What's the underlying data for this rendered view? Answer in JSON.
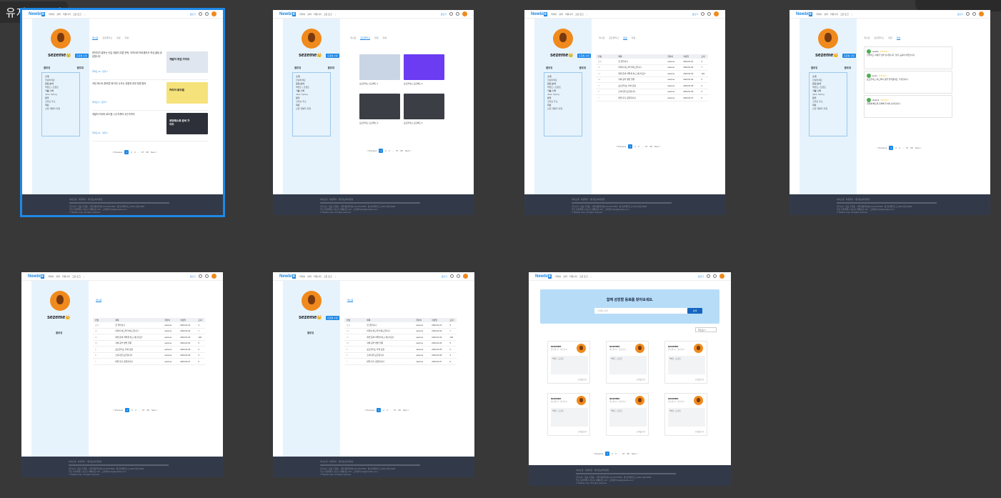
{
  "frame_label": "유저 프로필",
  "nav": {
    "logo": "Newbi",
    "logo_box": "e",
    "menu": [
      "커리어",
      "강좌",
      "커뮤니티",
      "고민 토크"
    ],
    "more": "⋮",
    "write": "글쓰기"
  },
  "profile": {
    "name": "sezeme",
    "crown": "👑",
    "edit": "프로필 수정",
    "stats": [
      "팔로잉",
      "팔로워"
    ],
    "box_lines": [
      "소개",
      "안녕하세요",
      "관심 분야",
      "백엔드 | 프론트",
      "기술 스택",
      "Java, Spring",
      "링크",
      "깃허브 주소",
      "목표",
      "신입 개발자 취업"
    ],
    "solo_stat": "팔로잉"
  },
  "tabs": {
    "feed": [
      "게시글",
      "포트폴리오",
      "댓글",
      "리뷰"
    ],
    "board": [
      "게시글"
    ]
  },
  "pagination": {
    "prev": "< Previous",
    "pages": [
      "1",
      "2",
      "3",
      "...",
      "67",
      "68"
    ],
    "next": "Next >"
  },
  "posts": [
    {
      "text": "현직자가 말하는 신입 개발자 취업 전략, 이력서와 포트폴리오 작성 꿀팁 공유합니다",
      "meta": "좋아요 12 · 댓글 3"
    },
    {
      "text": "코딩 테스트 준비할 때 자주 나오는 유형과 공부 방법 정리",
      "meta": "좋아요 8 · 댓글 5"
    },
    {
      "text": "개발자 커리어 로드맵, 1년 차부터 3년 차까지",
      "meta": "좋아요 21 · 댓글 9"
    }
  ],
  "thumbs": [
    {
      "label": "개발자 취업 가이드",
      "color": "#dfe6ef"
    },
    {
      "label": "커리어 로드맵",
      "color": "#f6e27a"
    },
    {
      "label": "코딩테스트 준비 가이드",
      "color": "#2d3039"
    }
  ],
  "gallery": [
    {
      "caption": "포트폴리오 프로젝트 1",
      "color": "#c9d4e4"
    },
    {
      "caption": "포트폴리오 프로젝트 2",
      "color": "#6b3cf2"
    },
    {
      "caption": "포트폴리오 프로젝트 3",
      "color": "#3b3e45"
    },
    {
      "caption": "포트폴리오 프로젝트 4",
      "color": "#3b3e45"
    }
  ],
  "table": {
    "headers": [
      "번호",
      "제목",
      "글쓴이",
      "작성일",
      "조회"
    ],
    "rows": [
      [
        "공지",
        "첫 글입니다",
        "sezeme",
        "2024.01.01",
        "3"
      ],
      [
        "12",
        "이력서 피드백 부탁드립니다",
        "sezeme",
        "2024.01.02",
        "7"
      ],
      [
        "11",
        "취업 준비 어떻게 하고 계신가요?",
        "sezeme",
        "2024.01.03",
        "104"
      ],
      [
        "10",
        "자바 공부 방법 질문",
        "sezeme",
        "2024.01.04",
        "5"
      ],
      [
        "9",
        "포트폴리오 리뷰 요청",
        "sezeme",
        "2024.01.05",
        "2"
      ],
      [
        "8",
        "스터디원 모집합니다",
        "sezeme",
        "2024.01.06",
        "3"
      ],
      [
        "7",
        "면접 후기 공유합니다",
        "sezeme",
        "2024.01.07",
        "0"
      ]
    ]
  },
  "reviews": [
    {
      "who": "newbie",
      "stars": "★★★★☆",
      "text": "친절하고 자세한 답변 감사합니다. 많은 도움이 되었습니다."
    },
    {
      "who": "junior",
      "stars": "★★★★☆",
      "text": "포트폴리오 피드백이 정말 유익했어요. 추천합니다."
    },
    {
      "who": "student",
      "stars": "★★★★☆",
      "text": "질문에 빠르게 답변해 주셔서 감사합니다."
    }
  ],
  "search": {
    "title": "함께 성장할 동료를 찾아보세요.",
    "placeholder": "닉네임 검색",
    "button": "검색",
    "sort": "최신순 ▾"
  },
  "users": [
    {
      "name": "sezeme",
      "tag": "팔로워 12 · 팔로잉 8",
      "box": "백엔드 | 프론트",
      "foot": "프로필 보기"
    },
    {
      "name": "sezeme",
      "tag": "팔로워 12 · 팔로잉 8",
      "box": "백엔드 | 프론트",
      "foot": "프로필 보기"
    },
    {
      "name": "sezeme",
      "tag": "팔로워 12 · 팔로잉 8",
      "box": "백엔드 | 프론트",
      "foot": "프로필 보기"
    },
    {
      "name": "sezeme",
      "tag": "팔로워 12 · 팔로잉 8",
      "box": "백엔드 | 프론트",
      "foot": "프로필 보기"
    },
    {
      "name": "sezeme",
      "tag": "팔로워 12 · 팔로잉 8",
      "box": "백엔드 | 프론트",
      "foot": "프로필 보기"
    },
    {
      "name": "sezeme",
      "tag": "팔로워 12 · 팔로잉 8",
      "box": "백엔드 | 프론트",
      "foot": "프로필 보기"
    }
  ],
  "footer": {
    "links": "회사소개 · 이용약관 · 개인정보처리방침",
    "line1": "(주)뉴비 · 대표 홍길동 · 사업자등록번호 123-45-67890 · 통신판매업신고 2024-서울-0000",
    "line2": "주소 서울특별시 강남구 테헤란로 123 · 고객센터 help@newbie.com",
    "copy": "© Newbie Corp. All rights reserved."
  }
}
